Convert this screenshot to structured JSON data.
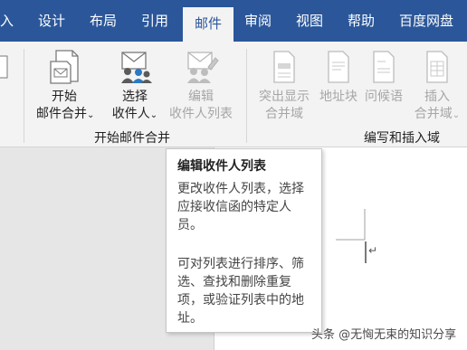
{
  "tabs": [
    {
      "label": "入"
    },
    {
      "label": "设计"
    },
    {
      "label": "布局"
    },
    {
      "label": "引用"
    },
    {
      "label": "邮件",
      "active": true
    },
    {
      "label": "审阅"
    },
    {
      "label": "视图"
    },
    {
      "label": "帮助"
    },
    {
      "label": "百度网盘"
    }
  ],
  "ribbon": {
    "start_merge": {
      "start_btn": {
        "line1": "开始",
        "line2": "邮件合并",
        "icon": "mail-merge-start-icon"
      },
      "select_btn": {
        "line1": "选择",
        "line2": "收件人",
        "icon": "select-recipients-icon"
      },
      "edit_btn": {
        "line1": "编辑",
        "line2": "收件人列表",
        "icon": "edit-recipient-list-icon"
      },
      "label": "开始邮件合并"
    },
    "write_insert": {
      "highlight_btn": {
        "line1": "突出显示",
        "line2": "合并域"
      },
      "address_btn": {
        "line1": "地址块"
      },
      "greeting_btn": {
        "line1": "问候语"
      },
      "insert_btn": {
        "line1": "插入",
        "line2": "合并域"
      },
      "label": "编写和插入域"
    }
  },
  "tooltip": {
    "title": "编辑收件人列表",
    "description": "更改收件人列表，选择应接收信函的特定人员。",
    "detail": "可对列表进行排序、筛选、查找和删除重复项，或验证列表中的地址。"
  },
  "watermark": "头条 @无恟无束的知识分享",
  "colors": {
    "ribbon_blue": "#2b579a",
    "ribbon_bg": "#f3f3f3"
  }
}
